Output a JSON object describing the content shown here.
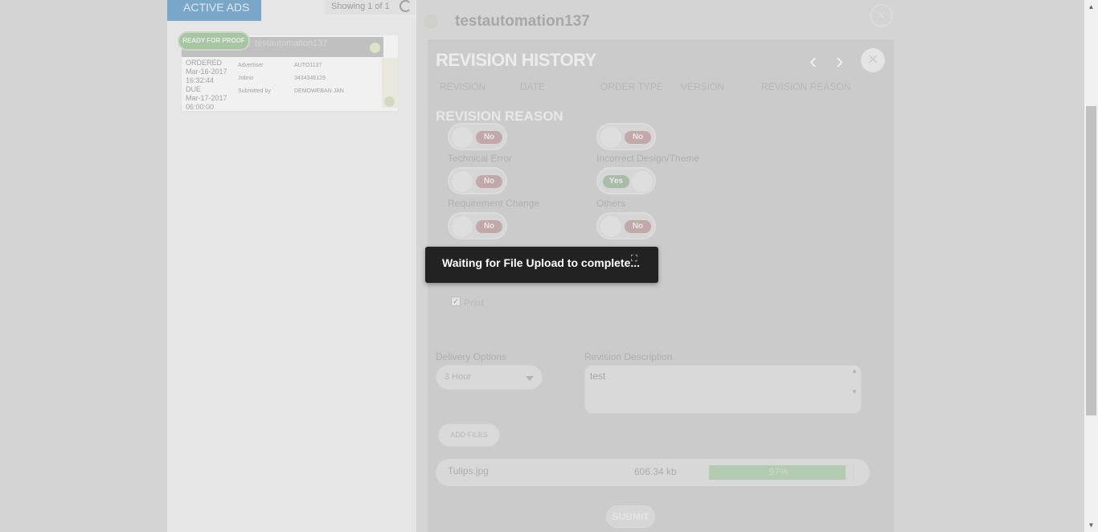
{
  "ads": {
    "tab_label": "ACTIVE ADS",
    "showing": "Showing 1 of 1",
    "card": {
      "badge": "READY FOR PROOF",
      "title": "testautomation137",
      "ordered_label": "ORDERED",
      "ordered_date": "Mar-16-2017",
      "ordered_time": "16:32:44",
      "due_label": "DUE",
      "due_date": "Mar-17-2017",
      "due_time": "06:00:00",
      "advertiser_label": "Advertiser",
      "advertiser_value": "AUTO1137",
      "jobno_label": "Jobno",
      "jobno_value": "3434346129",
      "submitted_label": "Submitted by",
      "submitted_value": "DEMOWEBAN JAN"
    }
  },
  "modal": {
    "title": "testautomation137",
    "close_symbol": "×"
  },
  "revision": {
    "heading": "REVISION HISTORY",
    "prev_symbol": "‹",
    "next_symbol": "›",
    "close_symbol": "×",
    "columns": [
      "REVISION",
      "DATE",
      "ORDER TYPE",
      "VERSION",
      "REVISION REASON"
    ],
    "reason_heading": "REVISION REASON",
    "toggles": [
      {
        "label": "",
        "state": "No"
      },
      {
        "label": "",
        "state": "No"
      },
      {
        "label": "Technical Error",
        "state": "No"
      },
      {
        "label": "Incorrect Design/Theme",
        "state": "Yes"
      },
      {
        "label": "Requirement Change",
        "state": "No"
      },
      {
        "label": "Others",
        "state": "No"
      }
    ],
    "print_label": "Print",
    "print_checked": true,
    "delivery_label": "Delivery Options",
    "delivery_value": "3 Hour",
    "description_label": "Revision Description",
    "description_value": "test",
    "add_files_label": "ADD FILES",
    "file": {
      "name": "Tulips.jpg",
      "size": "606.34 kb",
      "progress_text": "97%",
      "progress": 0.97
    },
    "submit_label": "SUBMIT"
  },
  "toast": {
    "message": "Waiting for File Upload to complete..."
  }
}
